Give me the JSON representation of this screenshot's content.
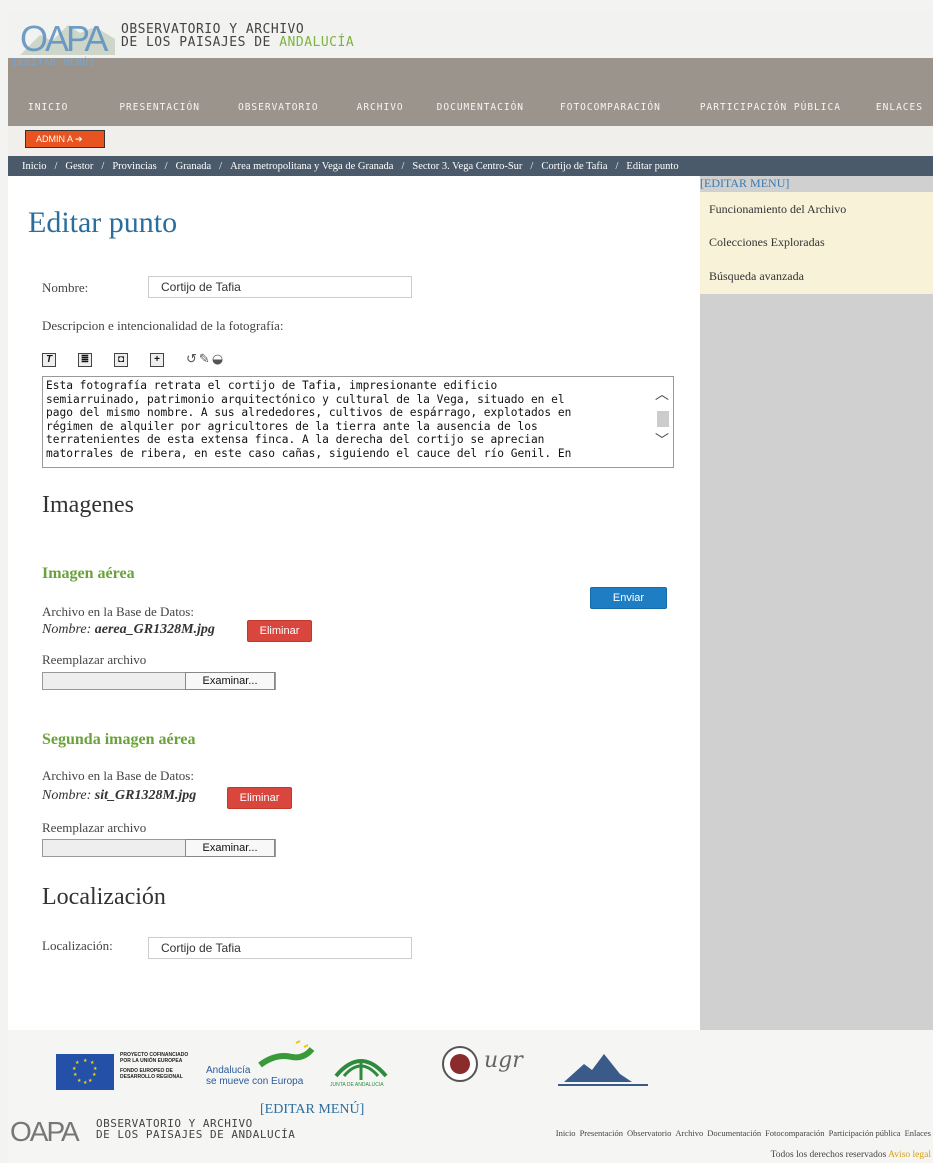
{
  "header": {
    "logo_line1": "OBSERVATORIO Y ARCHIVO",
    "logo_line2_a": "DE LOS PAISAJES DE ",
    "logo_line2_b": "ANDALUCÍA",
    "edit_menu": "[EDITAR MENÚ]"
  },
  "nav": {
    "items": [
      "INICIO",
      "PRESENTACIÓN",
      "OBSERVATORIO",
      "ARCHIVO",
      "DOCUMENTACIÓN",
      "FOTOCOMPARACIÓN",
      "PARTICIPACIÓN PÚBLICA",
      "ENLACES"
    ]
  },
  "admin": {
    "label": "ADMIN A"
  },
  "breadcrumb": [
    "Inicio",
    "Gestor",
    "Provincias",
    "Granada",
    "Area metropolitana y Vega de Granada",
    "Sector 3. Vega Centro-Sur",
    "Cortijo de Tafia",
    "Editar punto"
  ],
  "sidebar": {
    "edit_menu": "[EDITAR MENU]",
    "items": [
      "Funcionamiento del Archivo",
      "Colecciones Exploradas",
      "Búsqueda avanzada"
    ]
  },
  "form": {
    "title": "Editar punto",
    "nombre_label": "Nombre:",
    "nombre_value": "Cortijo de Tafia",
    "descripcion_label": "Descripcion e intencionalidad de la fotografía:",
    "descripcion_lines": [
      "Esta fotografía retrata el cortijo de Tafia, impresionante edificio",
      "semiarruinado, patrimonio arquitectónico y cultural de la Vega, situado en el",
      "pago del mismo nombre. A sus alrededores, cultivos de espárrago, explotados en",
      "régimen de alquiler por agricultores de la tierra ante la ausencia de los",
      "terratenientes de esta extensa finca. A la derecha del cortijo se aprecian",
      "matorrales de ribera, en este caso cañas, siguiendo el cauce del río Genil. En"
    ],
    "imagenes_title": "Imagenes",
    "imagen_aerea": {
      "title": "Imagen aérea",
      "archivo_label": "Archivo en la Base de Datos:",
      "nombre_prefix": "Nombre: ",
      "filename": "aerea_GR1328M.jpg",
      "delete_label": "Eliminar",
      "replace_label": "Reemplazar archivo",
      "browse_label": "Examinar..."
    },
    "segunda_imagen": {
      "title": "Segunda imagen aérea",
      "archivo_label": "Archivo en la Base de Datos:",
      "nombre_prefix": "Nombre: ",
      "filename": "sit_GR1328M.jpg",
      "delete_label": "Eliminar",
      "replace_label": "Reemplazar archivo",
      "browse_label": "Examinar..."
    },
    "localizacion_title": "Localización",
    "localizacion_label": "Localización:",
    "localizacion_value": "Cortijo de Tafia",
    "submit_label": "Enviar"
  },
  "footer": {
    "eu_text_1": "PROYECTO COFINANCIADO",
    "eu_text_2": "POR LA UNIÓN EUROPEA",
    "eu_text_3": "FONDO EUROPEO DE",
    "eu_text_4": "DESARROLLO REGIONAL",
    "andalucia_1": "Andalucía",
    "andalucia_2": "se mueve con Europa",
    "junta": "JUNTA DE ANDALUCIA",
    "ugr": "ugr",
    "edit_menu": "[EDITAR MENÚ]",
    "logo_line1": "OBSERVATORIO Y ARCHIVO",
    "logo_line2": "DE LOS PAISAJES DE ANDALUCÍA",
    "links": [
      "Inicio",
      "Presentación",
      "Observatorio",
      "Archivo",
      "Documentación",
      "Fotocomparación",
      "Participación pública",
      "Enlaces"
    ],
    "rights": "Todos los derechos reservados",
    "legal": "Aviso legal"
  },
  "colors": {
    "nav_band": "#9b948d",
    "breadcrumb": "#4a5a6a",
    "title_blue": "#2a6e9e",
    "green": "#6aa23a",
    "admin_orange": "#e8531f",
    "delete_red": "#d9463e",
    "submit_blue": "#1f7dc4"
  },
  "icons": [
    "bold-icon",
    "list-icon",
    "image-icon",
    "plus-icon",
    "undo-icon",
    "spellcheck-icon",
    "arrow-right-icon"
  ]
}
